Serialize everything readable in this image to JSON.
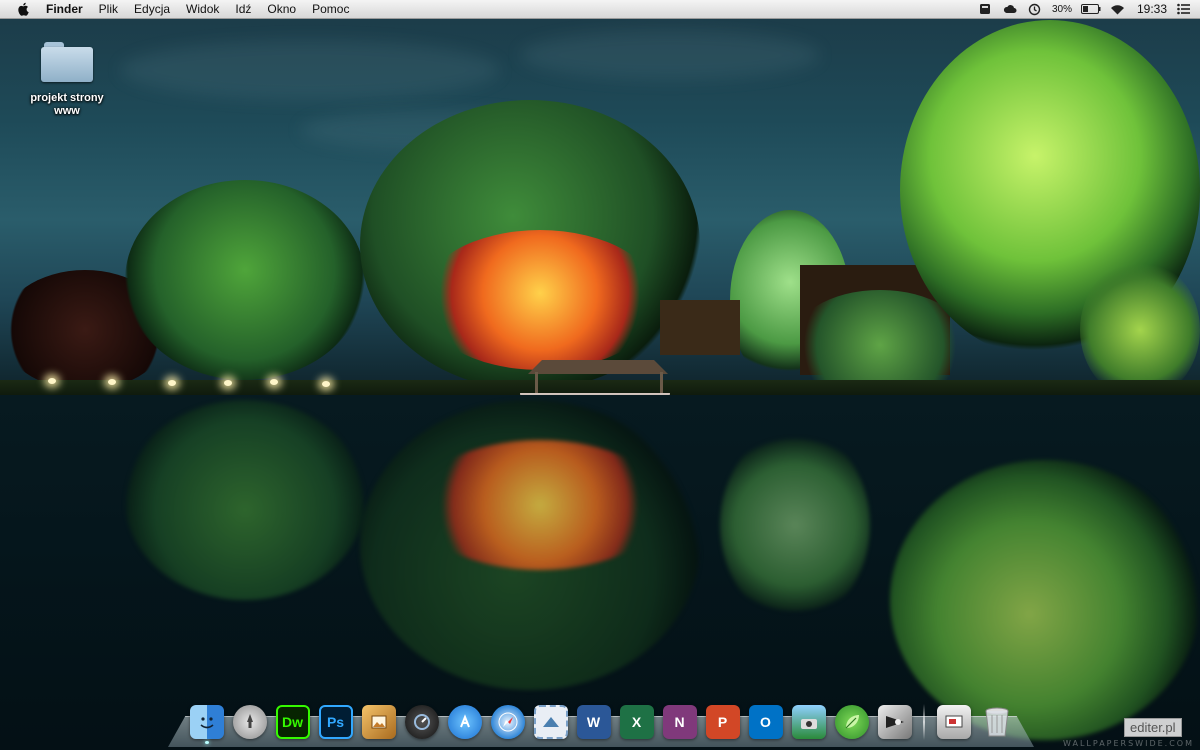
{
  "menubar": {
    "app_name": "Finder",
    "menus": [
      "Plik",
      "Edycja",
      "Widok",
      "Idź",
      "Okno",
      "Pomoc"
    ],
    "status": {
      "battery_percent": "30%",
      "clock": "19:33",
      "icons": [
        "drive-icon",
        "cloud-icon",
        "time-machine-icon",
        "battery-icon",
        "wifi-icon",
        "list-icon"
      ]
    }
  },
  "desktop": {
    "icons": [
      {
        "name": "projekt strony www",
        "icon": "folder-icon"
      }
    ]
  },
  "dock": {
    "items": [
      {
        "label": "Finder",
        "icon": "finder-icon",
        "running": true
      },
      {
        "label": "Launchpad",
        "icon": "launchpad-icon",
        "running": false
      },
      {
        "label": "Dreamweaver",
        "icon": "dreamweaver-icon",
        "text": "Dw",
        "running": false
      },
      {
        "label": "Photoshop",
        "icon": "photoshop-icon",
        "text": "Ps",
        "running": false
      },
      {
        "label": "Preview",
        "icon": "preview-icon",
        "running": false
      },
      {
        "label": "Dashboard",
        "icon": "dashboard-icon",
        "running": false
      },
      {
        "label": "App Store",
        "icon": "app-store-icon",
        "running": false
      },
      {
        "label": "Safari",
        "icon": "safari-icon",
        "running": false
      },
      {
        "label": "Mail",
        "icon": "mail-stamp-icon",
        "running": false
      },
      {
        "label": "Word",
        "icon": "word-icon",
        "text": "W",
        "running": false
      },
      {
        "label": "Excel",
        "icon": "excel-icon",
        "text": "X",
        "running": false
      },
      {
        "label": "OneNote",
        "icon": "onenote-icon",
        "text": "N",
        "running": false
      },
      {
        "label": "PowerPoint",
        "icon": "powerpoint-icon",
        "text": "P",
        "running": false
      },
      {
        "label": "Outlook",
        "icon": "outlook-icon",
        "text": "O",
        "running": false
      },
      {
        "label": "Image Capture",
        "icon": "image-capture-icon",
        "running": false
      },
      {
        "label": "Leaf",
        "icon": "leaf-icon",
        "running": false
      },
      {
        "label": "Grab",
        "icon": "screenshot-icon",
        "running": false
      },
      {
        "label": "Preview Scanner",
        "icon": "scanner-icon",
        "running": false
      },
      {
        "label": "Trash",
        "icon": "trash-icon",
        "running": false
      }
    ]
  },
  "watermark": "WALLPAPERSWIDE.COM",
  "overlay_badge": "editer.pl",
  "colors": {
    "menubar_bg": "#e6e6e6",
    "dreamweaver": "#35fa00",
    "photoshop": "#31a8ff",
    "word": "#2b5797",
    "excel": "#1e7145",
    "onenote": "#80397b",
    "powerpoint": "#d24726",
    "outlook": "#0072c6"
  }
}
